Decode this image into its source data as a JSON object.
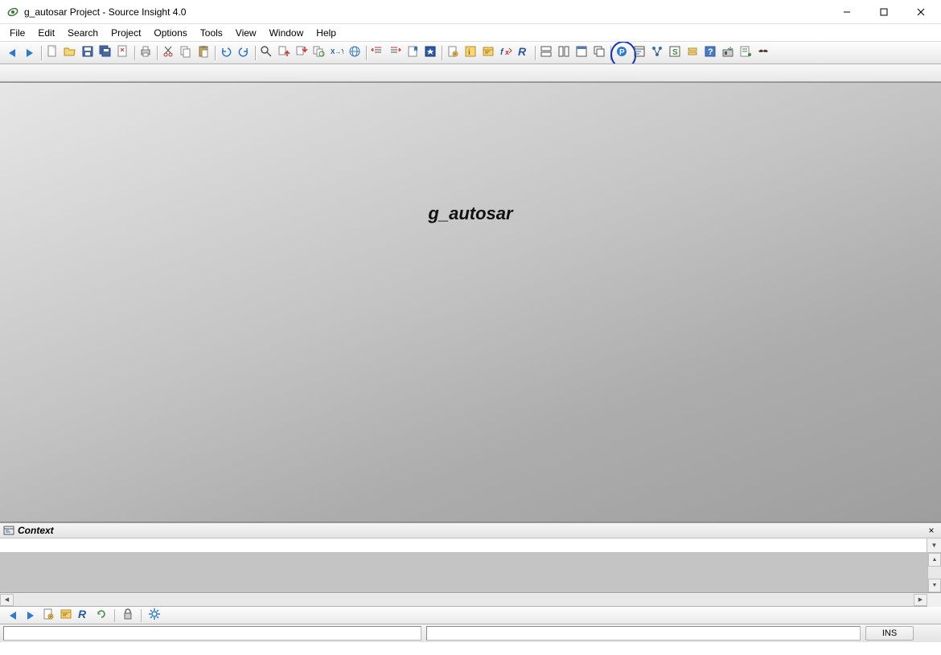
{
  "window": {
    "title": "g_autosar Project - Source Insight 4.0",
    "minimize": "—",
    "maximize": "☐",
    "close": "✕"
  },
  "menu": {
    "items": [
      "File",
      "Edit",
      "Search",
      "Project",
      "Options",
      "Tools",
      "View",
      "Window",
      "Help"
    ]
  },
  "toolbar": {
    "groups": [
      {
        "name": "nav",
        "buttons": [
          {
            "name": "back-button",
            "icon": "arrow-left"
          },
          {
            "name": "forward-button",
            "icon": "arrow-right"
          }
        ]
      },
      {
        "name": "file",
        "buttons": [
          {
            "name": "new-document-button",
            "icon": "doc"
          },
          {
            "name": "open-button",
            "icon": "folder-open"
          },
          {
            "name": "save-button",
            "icon": "save"
          },
          {
            "name": "save-all-button",
            "icon": "save-all"
          },
          {
            "name": "close-button",
            "icon": "close-doc"
          }
        ]
      },
      {
        "name": "print",
        "buttons": [
          {
            "name": "print-button",
            "icon": "printer"
          }
        ]
      },
      {
        "name": "edit",
        "buttons": [
          {
            "name": "cut-button",
            "icon": "cut"
          },
          {
            "name": "copy-button",
            "icon": "copy"
          },
          {
            "name": "paste-button",
            "icon": "paste"
          }
        ]
      },
      {
        "name": "undo",
        "buttons": [
          {
            "name": "undo-button",
            "icon": "undo"
          },
          {
            "name": "redo-button",
            "icon": "redo"
          }
        ]
      },
      {
        "name": "search",
        "buttons": [
          {
            "name": "search-button",
            "icon": "search"
          },
          {
            "name": "search-up-button",
            "icon": "search-up"
          },
          {
            "name": "search-down-button",
            "icon": "search-down"
          },
          {
            "name": "search-files-button",
            "icon": "search-files"
          },
          {
            "name": "replace-button",
            "icon": "replace"
          },
          {
            "name": "search-web-button",
            "icon": "web"
          }
        ]
      },
      {
        "name": "bookmark",
        "buttons": [
          {
            "name": "indent-left-button",
            "icon": "indent-l"
          },
          {
            "name": "indent-right-button",
            "icon": "indent-r"
          },
          {
            "name": "bookmark-toggle-button",
            "icon": "bm-toggle"
          },
          {
            "name": "bookmark-button",
            "icon": "bm"
          }
        ]
      },
      {
        "name": "symbol",
        "buttons": [
          {
            "name": "jump-def-button",
            "icon": "jump"
          },
          {
            "name": "symbol-info-button",
            "icon": "sym-info"
          },
          {
            "name": "browse-button",
            "icon": "browse"
          },
          {
            "name": "refs-button",
            "icon": "refs"
          },
          {
            "name": "relation-button",
            "icon": "relation"
          }
        ]
      },
      {
        "name": "layout",
        "buttons": [
          {
            "name": "tile-h-button",
            "icon": "tile-h"
          },
          {
            "name": "tile-v-button",
            "icon": "tile-v"
          },
          {
            "name": "tile-one-button",
            "icon": "tile-one"
          },
          {
            "name": "cascade-button",
            "icon": "cascade"
          }
        ]
      },
      {
        "name": "panels",
        "buttons": [
          {
            "name": "project-window-button",
            "icon": "project-p",
            "circled": true
          },
          {
            "name": "context-window-button",
            "icon": "context"
          },
          {
            "name": "relation-window-button",
            "icon": "rel-win"
          },
          {
            "name": "symbol-window-button",
            "icon": "sym-win"
          },
          {
            "name": "clip-window-button",
            "icon": "clip"
          },
          {
            "name": "help-button",
            "icon": "help"
          },
          {
            "name": "ftp-button",
            "icon": "ftp"
          },
          {
            "name": "snippets-button",
            "icon": "snip"
          },
          {
            "name": "bird-button",
            "icon": "bird"
          }
        ]
      }
    ]
  },
  "workspace": {
    "project_name": "g_autosar"
  },
  "context_panel": {
    "title": "Context",
    "close": "×",
    "input_value": ""
  },
  "mini_toolbar": {
    "buttons": [
      {
        "name": "mini-back-button",
        "icon": "arrow-left"
      },
      {
        "name": "mini-forward-button",
        "icon": "arrow-right"
      },
      {
        "name": "mini-jump-button",
        "icon": "jump"
      },
      {
        "name": "mini-browse-button",
        "icon": "browse"
      },
      {
        "name": "mini-relation-button",
        "icon": "relation"
      },
      {
        "name": "mini-refresh-button",
        "icon": "refresh"
      },
      {
        "name": "sep"
      },
      {
        "name": "mini-lock-button",
        "icon": "lock"
      },
      {
        "name": "sep"
      },
      {
        "name": "mini-settings-button",
        "icon": "gear"
      }
    ]
  },
  "statusbar": {
    "field1": "",
    "field2": "",
    "ins": "INS"
  }
}
